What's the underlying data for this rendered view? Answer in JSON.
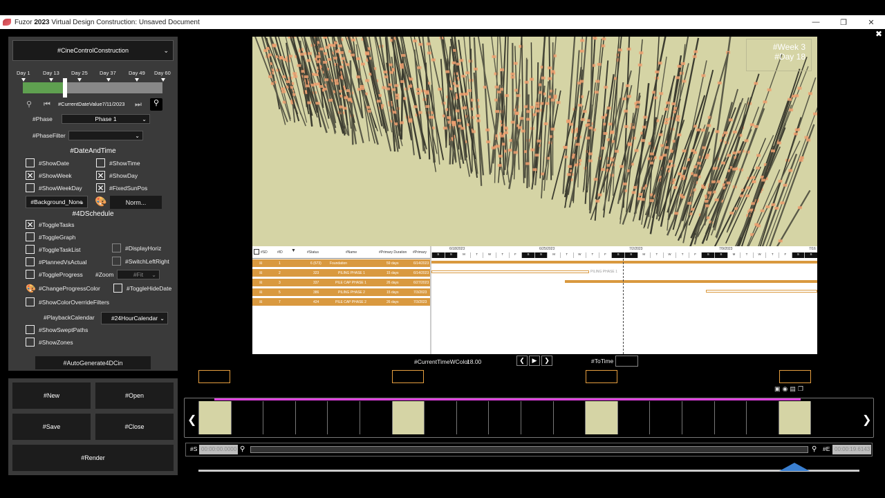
{
  "window": {
    "title": "Fuzor 𝟐𝟎𝟐𝟑 Virtual Design Construction: Unsaved Document"
  },
  "panel": {
    "cine_select": "#CineControlConstruction",
    "day_labels": [
      "Day 1",
      "Day 13",
      "Day 25",
      "Day 37",
      "Day 49",
      "Day 60"
    ],
    "progress": 0.3,
    "current_date": "#CurrentDateValue7/11/2023",
    "phase_label": "#Phase",
    "phase_value": "Phase 1",
    "phase_filter_label": "#PhaseFilter",
    "phase_filter_value": "",
    "date_time_heading": "#DateAndTime",
    "checks": {
      "show_date": {
        "label": "#ShowDate",
        "checked": false
      },
      "show_time": {
        "label": "#ShowTime",
        "checked": false
      },
      "show_week": {
        "label": "#ShowWeek",
        "checked": true
      },
      "show_day": {
        "label": "#ShowDay",
        "checked": true
      },
      "show_week_day": {
        "label": "#ShowWeekDay",
        "checked": false
      },
      "fixed_sun_pos": {
        "label": "#FixedSunPos",
        "checked": true
      }
    },
    "background_select": "#Background_None",
    "norm_button": "Norm...",
    "schedule_heading": "#4DSchedule",
    "schedule_checks": {
      "toggle_tasks": "#ToggleTasks",
      "toggle_graph": "#ToggleGraph",
      "toggle_task_list": "#ToggleTaskList",
      "display_horiz": "#DisplayHoriz",
      "planned_vs_actual": "#PlannedVsActual",
      "switch_left_right": "#SwitchLeftRight",
      "toggle_progress": "#ToggleProgress",
      "zoom": "#Zoom",
      "zoom_value": "#Fit",
      "change_progress_color": "#ChangeProgressColor",
      "toggle_hide_date": "#ToggleHideDate",
      "show_color_override": "#ShowColorOverrideFilters",
      "playback_calendar": "#PlaybackCalendar",
      "calendar_value": "#24HourCalendar",
      "show_swept_paths": "#ShowSweptPaths",
      "show_zones": "#ShowZones"
    },
    "auto_generate": "#AutoGenerate4DCin"
  },
  "file_panel": {
    "new": "#New",
    "open": "#Open",
    "save": "#Save",
    "close": "#Close",
    "render": "#Render"
  },
  "viewport": {
    "week": "#Week 3",
    "day": "#Day 18"
  },
  "gantt": {
    "headers": [
      "#SD",
      "#ID",
      "#Status",
      "#Name",
      "#Primary Duration",
      "#Primary"
    ],
    "dates": [
      "6/18/2023",
      "6/25/2023",
      "7/2/2023",
      "7/9/2023",
      "7/16"
    ],
    "rows": [
      {
        "id": "1",
        "code": "6 (673)",
        "name": "Foundation",
        "dur": "59 days",
        "start": "6/14/2023"
      },
      {
        "id": "2",
        "code": "323",
        "name": "PILING PHASE 1",
        "dur": "15 days",
        "start": "6/14/2023"
      },
      {
        "id": "3",
        "code": "337",
        "name": "PILE CAP PHASE 1",
        "dur": "26 days",
        "start": "6/27/2023"
      },
      {
        "id": "5",
        "code": "386",
        "name": "PILING PHASE 2",
        "dur": "15 days",
        "start": "7/3/2023"
      },
      {
        "id": "7",
        "code": "424",
        "name": "PILE CAP PHASE 2",
        "dur": "26 days",
        "start": "7/3/2023"
      }
    ],
    "bar_label": "PILING PHASE 1"
  },
  "time": {
    "current_time_label": "#CurrentTimeWColor",
    "current_time_value": "18.00",
    "to_time_label": "#ToTime",
    "start_label": "#S",
    "start_value": "00:00:00.0000",
    "end_label": "#E",
    "end_value": "00:00:19.6143"
  },
  "colors": {
    "accent": "#e8a040",
    "magenta": "#e040e0",
    "green": "#5fa050",
    "viewport": "#d5d4a5"
  }
}
